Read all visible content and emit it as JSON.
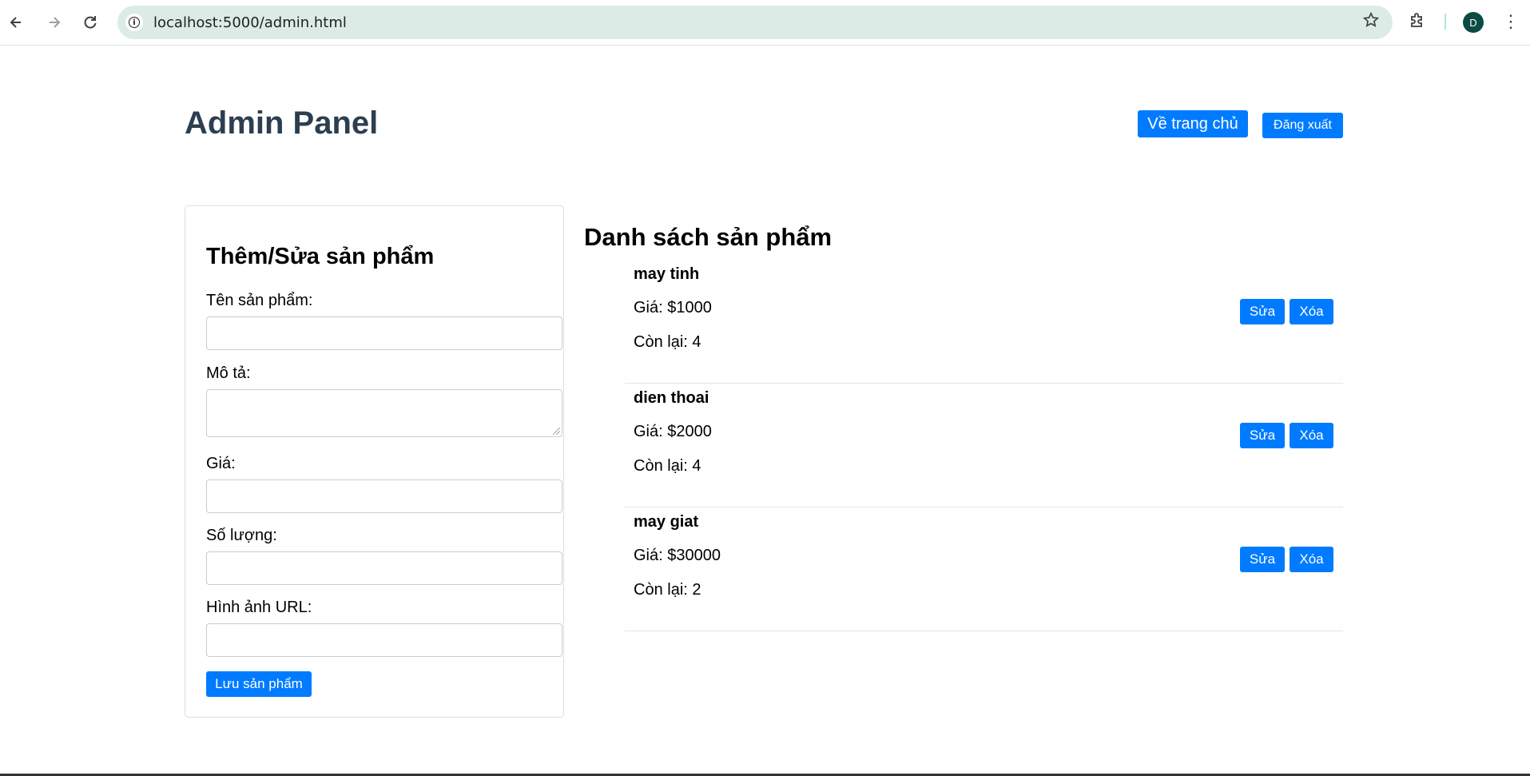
{
  "browser": {
    "url": "localhost:5000/admin.html",
    "profile_initial": "D",
    "icons": [
      "back-icon",
      "forward-icon",
      "reload-icon",
      "info-icon",
      "star-icon",
      "extensions-icon",
      "menu-dots-icon"
    ]
  },
  "header": {
    "title": "Admin Panel",
    "home_button": "Về trang chủ",
    "logout_button": "Đăng xuất"
  },
  "form": {
    "title": "Thêm/Sửa sản phẩm",
    "name_label": "Tên sản phẩm:",
    "name_value": "",
    "description_label": "Mô tả:",
    "description_value": "",
    "price_label": "Giá:",
    "price_value": "",
    "quantity_label": "Số lượng:",
    "quantity_value": "",
    "image_label": "Hình ảnh URL:",
    "image_value": "",
    "save_button": "Lưu sản phẩm"
  },
  "products": {
    "title": "Danh sách sản phẩm",
    "edit_label": "Sửa",
    "delete_label": "Xóa",
    "items": [
      {
        "name": "may tinh",
        "price": "Giá: $1000",
        "stock": "Còn lại: 4"
      },
      {
        "name": "dien thoai",
        "price": "Giá: $2000",
        "stock": "Còn lại: 4"
      },
      {
        "name": "may giat",
        "price": "Giá: $30000",
        "stock": "Còn lại: 2"
      }
    ]
  },
  "colors": {
    "primary_button": "#007bff",
    "title_color": "#2c3e50",
    "omnibox_bg": "#dcebe6"
  }
}
